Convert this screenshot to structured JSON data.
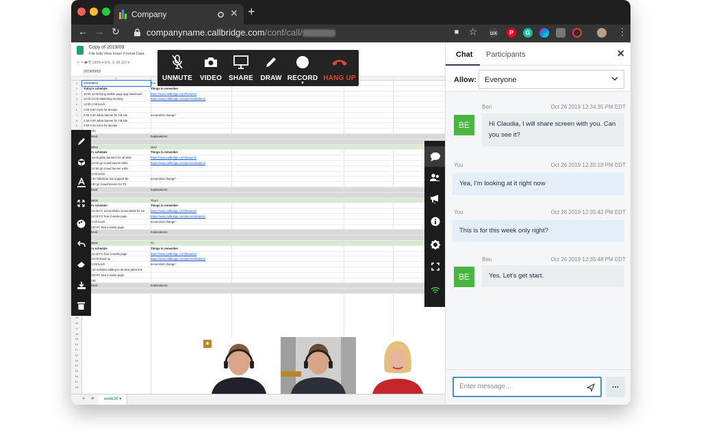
{
  "browser": {
    "tab_title": "Company",
    "new_tab": "+",
    "url_host": "companyname.callbridge.com",
    "url_path": "/conf/call/"
  },
  "spreadsheet": {
    "doc_name": "Copy of 2019/09",
    "menu": "File  Edit  View  Insert  Format  Data",
    "toolbar_text": "↶  ↷  🖶  ⎘   100% ▾   $  %  .0  .00  123 ▾",
    "cell_ref": "2019/09/03",
    "col_a": "A",
    "sheet_tab": "week36 ▾",
    "rows": [
      {
        "a": "2019/09/03",
        "b": "Tue",
        "style": "sel"
      },
      {
        "a": "Today's schedule",
        "b": "Things to remember",
        "style": "bold"
      },
      {
        "a": "10:00-11:00 fixing Mobile page app download l",
        "b": "https://www.callbridge.com/features/",
        "link": true
      },
      {
        "a": "11:00-12:00 Marketing meeting",
        "b": "https://www.callbridge.com/personalization/",
        "link": true
      },
      {
        "a": "12:00-1:00 lunch",
        "b": ""
      },
      {
        "a": "1:00-3:00 icons for devops",
        "b": ""
      },
      {
        "a": "3:00-3:30 Jabra banner for CB site",
        "b": "screenshot change*"
      },
      {
        "a": "3:30-4:00 Jabra banner for CB site",
        "b": ""
      },
      {
        "a": "4:00-4:15 icons for devops",
        "b": ""
      },
      {
        "a": "4:15-5:00",
        "b": ""
      },
      {
        "a": "Completed:",
        "b": "Explanations:",
        "style": "gray"
      },
      {
        "a": "Done",
        "b": "",
        "style": "gray"
      },
      {
        "a": "2019/09/04",
        "b": "Wed",
        "style": "green"
      },
      {
        "a": "Today's schedule",
        "b": "Things to remember",
        "style": "bold"
      },
      {
        "a": "10:00-11:00 jabra banners for all sites",
        "b": "https://www.callbridge.com/features/",
        "link": true
      },
      {
        "a": "11:00-12:00 g2 crowd banner edits",
        "b": "https://www.callbridge.com/personalization/",
        "link": true
      },
      {
        "a": "12:00-12:00 g2 crowd banner edits",
        "b": ""
      },
      {
        "a": "12:00-1:00 lunch",
        "b": ""
      },
      {
        "a": "1:30-2:30 TalkShow live support tile",
        "b": "screenshot change*"
      },
      {
        "a": "2:30-4:00 g2 crowd banner for TS",
        "b": ""
      },
      {
        "a": "Completed:",
        "b": "Explanations:",
        "style": "gray"
      },
      {
        "a": "Done",
        "b": "",
        "style": "gray"
      },
      {
        "a": "2019/09/05",
        "b": "Thurs",
        "style": "green"
      },
      {
        "a": "Today's schedule",
        "b": "Things to remember",
        "style": "bold"
      },
      {
        "a": "10:00-11:45 FC screenshare screenshots for Ka",
        "b": "https://www.callbridge.com/features/",
        "link": true
      },
      {
        "a": "11:45-12:00 FC how it works page",
        "b": "https://www.callbridge.com/personalization/",
        "link": true
      },
      {
        "a": "12:00-1:00 lunch",
        "b": "screenshot change*"
      },
      {
        "a": "1:00-5:00 FC how it works page",
        "b": ""
      },
      {
        "a": "Completed:",
        "b": "Explanations:",
        "style": "gray"
      },
      {
        "a": "Done",
        "b": "",
        "style": "gray"
      },
      {
        "a": "2019/09/06",
        "b": "Fri",
        "style": "green"
      },
      {
        "a": "Today's schedule",
        "b": "Things to remember",
        "style": "bold"
      },
      {
        "a": "10:00-11:45 FC how it works page",
        "b": "https://www.callbridge.com/features/",
        "link": true
      },
      {
        "a": "11:45-12:00 stand up",
        "b": "https://www.callbridge.com/personalization/",
        "link": true
      },
      {
        "a": "12:00-1:00 lunch",
        "b": "screenshot change*"
      },
      {
        "a": "1:00-1:10 nofollow adding to all sites jabra link",
        "b": ""
      },
      {
        "a": "1:10-4:00 FC how it works page",
        "b": ""
      },
      {
        "a": "4:00-5:00",
        "b": ""
      },
      {
        "a": "Completed:",
        "b": "Explanations:",
        "style": "gray"
      },
      {
        "a": "Done",
        "b": "",
        "style": "gray"
      }
    ]
  },
  "call_toolbar": {
    "unmute": "UNMUTE",
    "video": "VIDEO",
    "share": "SHARE",
    "draw": "DRAW",
    "record": "RECORD",
    "hang_up": "HANG UP"
  },
  "chat": {
    "tab_chat": "Chat",
    "tab_participants": "Participants",
    "allow_label": "Allow:",
    "allow_value": "Everyone",
    "messages": [
      {
        "sender": "Ben",
        "time": "Oct 26 2019 12:34:35 PM EDT",
        "avatar": "BE",
        "text": "Hi Claudia, I will share screen with you. Can you see it?"
      },
      {
        "sender": "You",
        "time": "Oct 26 2019 12:35:18 PM EDT",
        "text": "Yea, I'm looking at it right now"
      },
      {
        "sender": "You",
        "time": "Oct 26 2019 12:35:42 PM EDT",
        "text": "This is for this week only right?"
      },
      {
        "sender": "Ben",
        "time": "Oct 26 2019 12:35:48 PM EDT",
        "avatar": "BE",
        "text": "Yes. Let's get start."
      }
    ],
    "placeholder": "Enter message...",
    "more": "..."
  },
  "colors": {
    "accent_green": "#4bb543",
    "hang_up_red": "#e0453a",
    "toolbar_dark": "#232323",
    "wifi_green": "#3ec24d"
  }
}
